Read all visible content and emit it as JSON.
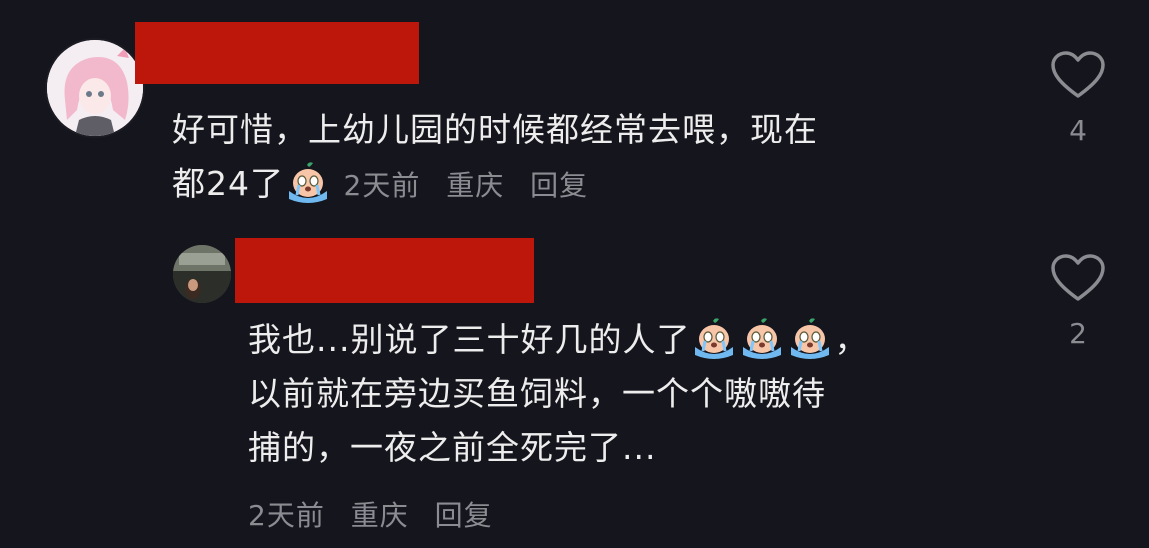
{
  "comment": {
    "text_line1": "好可惜，上幼儿园的时候都经常去喂，现在",
    "text_line2": "都24了",
    "time": "2天前",
    "location": "重庆",
    "reply_label": "回复",
    "like_count": "4"
  },
  "reply": {
    "text_line1": "我也...别说了三十好几的人了",
    "text_line1_end": "，",
    "text_line2": "以前就在旁边买鱼饲料，一个个嗷嗷待",
    "text_line3": "捕的，一夜之前全死完了...",
    "time": "2天前",
    "location": "重庆",
    "reply_label": "回复",
    "like_count": "2"
  },
  "icons": {
    "like": "heart-outline-icon",
    "emoji": "crying-emoji-icon"
  },
  "colors": {
    "background": "#15151d",
    "text": "#ededed",
    "meta": "#8b8b92",
    "redaction": "#bd170b"
  }
}
